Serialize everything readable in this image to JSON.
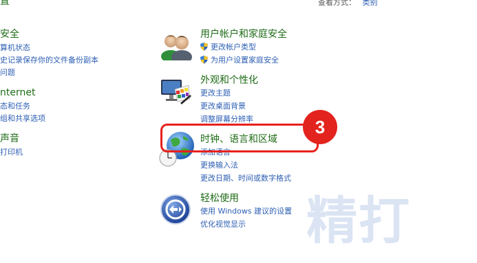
{
  "topbar": {
    "view_by": "查看方式：",
    "category": "类别"
  },
  "left_column": {
    "security_title": "安全",
    "security_links": [
      "算机状态",
      "史记录保存你的文件备份副本",
      "问题"
    ],
    "network_title": "nternet",
    "network_links": [
      "态和任务",
      "组和共享选项"
    ],
    "hardware_title": "声音",
    "hardware_links": [
      "打印机"
    ]
  },
  "user_accounts": {
    "title": "用户帐户和家庭安全",
    "links": [
      "更改帐户类型",
      "为用户设置家庭安全"
    ],
    "icon": "users-icon"
  },
  "appearance": {
    "title": "外观和个性化",
    "links": [
      "更改主题",
      "更改桌面背景",
      "调整屏幕分辨率"
    ],
    "icon": "monitor-palette-icon"
  },
  "clock_region": {
    "title": "时钟、语言和区域",
    "links": [
      "添加语言",
      "更换输入法",
      "更改日期、时间或数字格式"
    ],
    "icon": "globe-clock-icon"
  },
  "ease_access": {
    "title": "轻松使用",
    "links": [
      "使用 Windows 建议的设置",
      "优化视觉显示"
    ],
    "icon": "ease-of-access-icon"
  },
  "annotation": {
    "step": "3",
    "color": "#e3231e"
  },
  "watermark": "精打",
  "colors": {
    "title_green": "#1e6b16",
    "link_blue": "#2d5fb3"
  }
}
